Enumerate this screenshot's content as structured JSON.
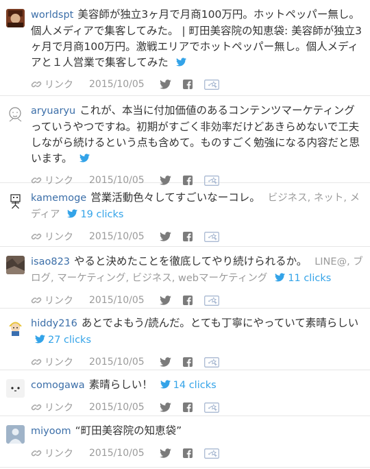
{
  "labels": {
    "link": "リンク"
  },
  "icons": {
    "link": "link-chain-icon",
    "twitter": "twitter-bird-icon",
    "facebook": "facebook-icon",
    "hatena": "hatena-bookmark-icon"
  },
  "colors": {
    "username": "#3b6ea8",
    "clicks": "#33a3e8",
    "meta": "#9a9a9a",
    "divider": "#e6e6e6"
  },
  "comments": [
    {
      "user": "worldspt",
      "text": "美容師が独立3ヶ月で月商100万円。ホットペッパー無し。個人メディアで集客してみた。 | 町田美容院の知恵袋: 美容師が独立3ヶ月で月商100万円。激戦エリアでホットペッパー無し。個人メディアと１人営業で集客してみた",
      "tags": "",
      "clicks": "",
      "date": "2015/10/05"
    },
    {
      "user": "aryuaryu",
      "text": "これが、本当に付加価値のあるコンテンツマーケティングっていうやつですね。初期がすごく非効率だけどあきらめないで工夫しながら続けるという点も含めて。ものすごく勉強になる内容だと思います。",
      "tags": "",
      "clicks": "",
      "date": "2015/10/05"
    },
    {
      "user": "kamemoge",
      "text": "営業活動色々してすごいなーコレ。",
      "tags": "ビジネス, ネット, メディア",
      "clicks": "19 clicks",
      "date": "2015/10/05"
    },
    {
      "user": "isao823",
      "text": "やると決めたことを徹底してやり続けられるか。",
      "tags": "LINE@, ブログ, マーケティング, ビジネス, webマーケティング",
      "clicks": "11 clicks",
      "date": "2015/10/05"
    },
    {
      "user": "hiddy216",
      "text": "あとでよもう/読んだ。とても丁寧にやっていて素晴らしい",
      "tags": "",
      "clicks": "27 clicks",
      "date": "2015/10/05"
    },
    {
      "user": "comogawa",
      "text": "素晴らしい！",
      "tags": "",
      "clicks": "14 clicks",
      "date": "2015/10/05"
    },
    {
      "user": "miyoom",
      "text": "“町田美容院の知恵袋”",
      "tags": "",
      "clicks": "",
      "date": "2015/10/05"
    }
  ]
}
